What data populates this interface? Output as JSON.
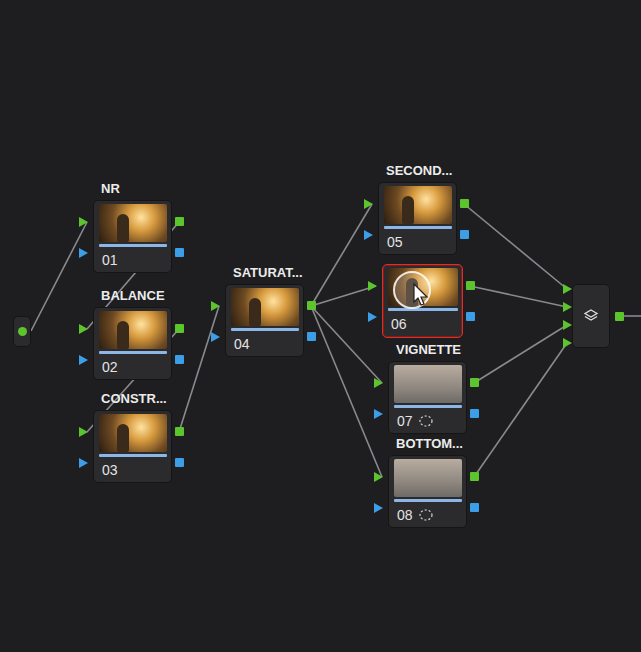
{
  "nodes": [
    {
      "id": "01",
      "label": "NR",
      "number": "01",
      "selected": false,
      "kind": "plain"
    },
    {
      "id": "02",
      "label": "BALANCE",
      "number": "02",
      "selected": false,
      "kind": "plain"
    },
    {
      "id": "03",
      "label": "CONSTR...",
      "number": "03",
      "selected": false,
      "kind": "plain"
    },
    {
      "id": "04",
      "label": "SATURAT...",
      "number": "04",
      "selected": false,
      "kind": "plain"
    },
    {
      "id": "05",
      "label": "SECOND...",
      "number": "05",
      "selected": false,
      "kind": "plain"
    },
    {
      "id": "06",
      "number": "06",
      "selected": true,
      "kind": "plain"
    },
    {
      "id": "07",
      "label": "VIGNETTE",
      "number": "07",
      "selected": false,
      "kind": "window"
    },
    {
      "id": "08",
      "label": "BOTTOM...",
      "number": "08",
      "selected": false,
      "kind": "window"
    }
  ],
  "edges": [
    [
      "source",
      "01"
    ],
    [
      "01",
      "02"
    ],
    [
      "02",
      "03"
    ],
    [
      "03",
      "04"
    ],
    [
      "04",
      "05"
    ],
    [
      "04",
      "06"
    ],
    [
      "04",
      "07"
    ],
    [
      "04",
      "08"
    ],
    [
      "05",
      "mixer"
    ],
    [
      "06",
      "mixer"
    ],
    [
      "07",
      "mixer"
    ],
    [
      "08",
      "mixer"
    ],
    [
      "mixer",
      "output"
    ]
  ]
}
